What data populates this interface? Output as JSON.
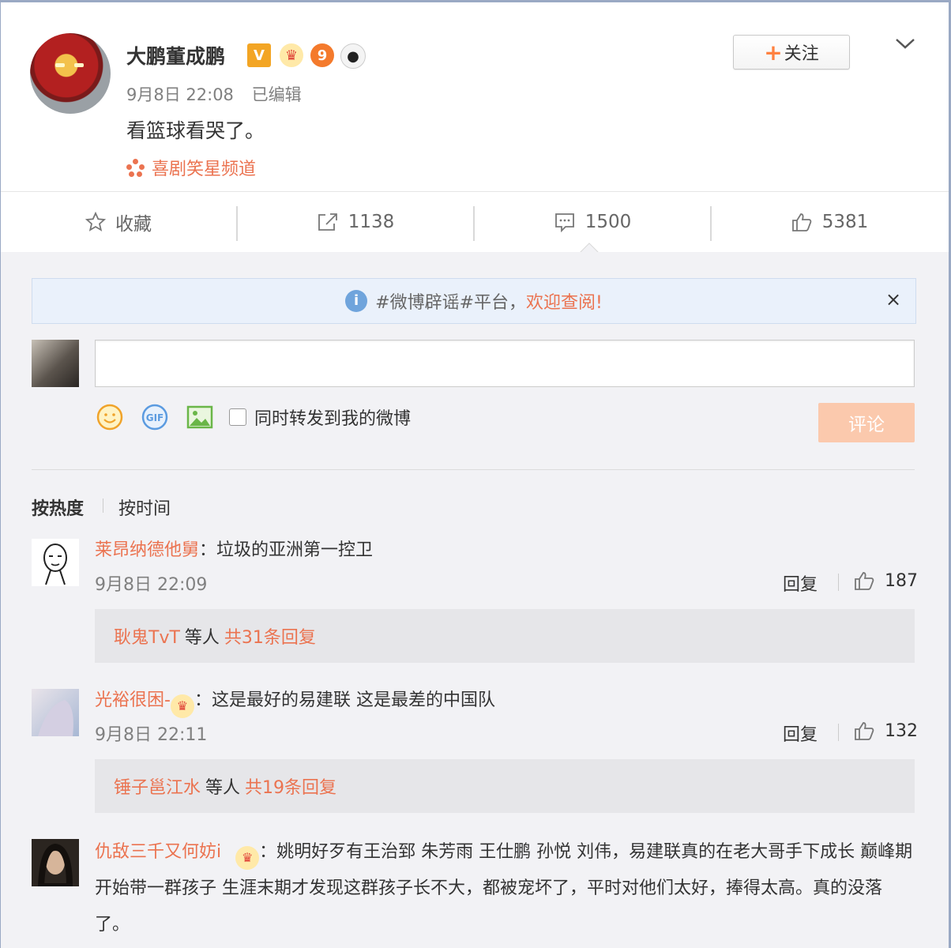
{
  "post": {
    "username": "大鹏董成鹏",
    "badges": [
      "V",
      "crown",
      "9",
      "panda"
    ],
    "time": "9月8日 22:08",
    "edited": "已编辑",
    "text": "看篮球看哭了。",
    "source": "喜剧笑星频道",
    "follow_label": "关注",
    "follow_plus": "+"
  },
  "actions": {
    "favorite": "收藏",
    "repost_count": "1138",
    "comment_count": "1500",
    "like_count": "5381"
  },
  "notice": {
    "prefix": "#微博辟谣#平台，",
    "link": "欢迎查阅!",
    "close": "×"
  },
  "composer": {
    "repost_label": "同时转发到我的微博",
    "submit": "评论"
  },
  "sort": {
    "hot": "按热度",
    "time": "按时间"
  },
  "comments": [
    {
      "name": "莱昂纳德他舅",
      "text": "：垃圾的亚洲第一控卫",
      "time": "9月8日 22:09",
      "reply": "回复",
      "likes": "187",
      "sub_name": "耿鬼TvT",
      "sub_mid": "等人",
      "sub_count": "共31条回复"
    },
    {
      "name": "光裕很困-",
      "text": "：这是最好的易建联 这是最差的中国队",
      "time": "9月8日 22:11",
      "reply": "回复",
      "likes": "132",
      "sub_name": "锤子邕江水",
      "sub_mid": "等人",
      "sub_count": "共19条回复"
    },
    {
      "name": "仇敌三千又何妨і",
      "text": "：姚明好歹有王治郅 朱芳雨 王仕鹏 孙悦 刘伟，易建联真的在老大哥手下成长 巅峰期 开始带一群孩子 生涯末期才发现这群孩子长不大，都被宠坏了，平时对他们太好，捧得太高。真的没落了。"
    }
  ],
  "colors": {
    "accent": "#eb7350",
    "link_blue": "#6fa4dc",
    "submit_disabled": "#fbc9ad"
  },
  "icons": [
    "star-icon",
    "share-icon",
    "comment-icon",
    "like-icon",
    "info-icon",
    "emoji-icon",
    "gif-icon",
    "image-icon",
    "chevron-down-icon"
  ]
}
